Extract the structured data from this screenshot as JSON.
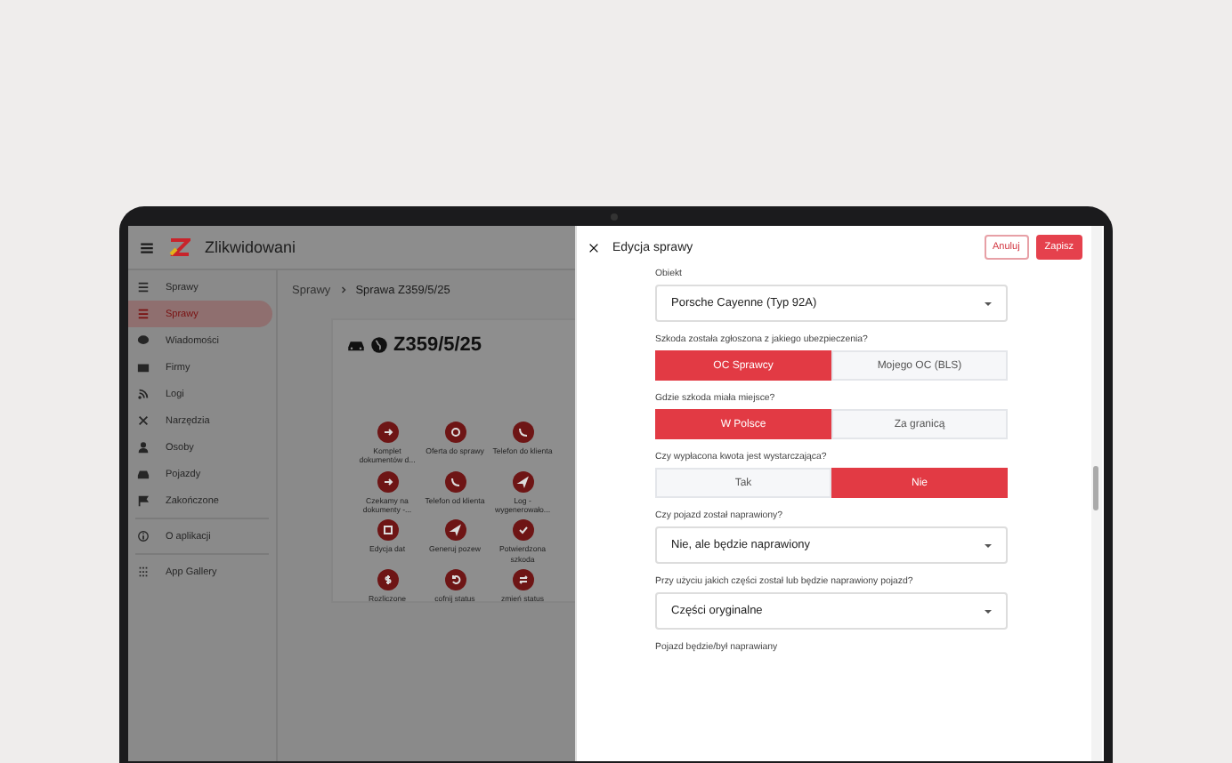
{
  "app": {
    "title": "Zlikwidowani",
    "sidebar": [
      [
        {
          "label": "Sprawy",
          "selected": false
        },
        {
          "label": "Sprawy",
          "selected": true
        },
        {
          "label": "Wiadomości",
          "selected": false
        },
        {
          "label": "Firmy",
          "selected": false
        },
        {
          "label": "Logi",
          "selected": false
        },
        {
          "label": "Narzędzia",
          "selected": false
        },
        {
          "label": "Osoby",
          "selected": false
        },
        {
          "label": "Pojazdy",
          "selected": false
        },
        {
          "label": "Zakończone",
          "selected": false
        }
      ],
      [
        {
          "label": "O aplikacji",
          "selected": false
        }
      ],
      [
        {
          "label": "App Gallery",
          "selected": false
        }
      ]
    ],
    "breadcrumb": [
      "Sprawy",
      "Sprawa Z359/5/25"
    ],
    "case": {
      "number": "Z359/5/25",
      "actions": [
        {
          "label": "Komplet dokumentów d..."
        },
        {
          "label": "Oferta do sprawy"
        },
        {
          "label": "Telefon do klienta"
        },
        {
          "label": "Czekamy na dokumenty -..."
        },
        {
          "label": "Telefon od klienta"
        },
        {
          "label": "Log - wygenerowało..."
        },
        {
          "label": "Edycja dat"
        },
        {
          "label": "Generuj pozew"
        },
        {
          "label": "Potwierdzona szkoda"
        },
        {
          "label": "Rozliczone"
        },
        {
          "label": "cofnij status"
        },
        {
          "label": "zmień status"
        }
      ]
    }
  },
  "drawer": {
    "title": "Edycja sprawy",
    "buttons": [
      {
        "label": "Anuluj",
        "kind": "outline"
      },
      {
        "label": "Zapisz",
        "kind": "primary"
      }
    ],
    "fields": [
      {
        "kind": "select",
        "label": "Obiekt",
        "value": "Porsche Cayenne (Typ 92A)"
      },
      {
        "kind": "toggle",
        "label": "Szkoda została zgłoszona z jakiego ubezpieczenia?",
        "options": [
          {
            "label": "OC Sprawcy",
            "selected": true
          },
          {
            "label": "Mojego OC (BLS)",
            "selected": false
          }
        ]
      },
      {
        "kind": "toggle",
        "label": "Gdzie szkoda miała miejsce?",
        "options": [
          {
            "label": "W Polsce",
            "selected": true
          },
          {
            "label": "Za granicą",
            "selected": false
          }
        ]
      },
      {
        "kind": "toggle",
        "label": "Czy wypłacona kwota jest wystarczająca?",
        "options": [
          {
            "label": "Tak",
            "selected": false
          },
          {
            "label": "Nie",
            "selected": true
          }
        ]
      },
      {
        "kind": "select",
        "label": "Czy pojazd został naprawiony?",
        "value": "Nie, ale będzie naprawiony"
      },
      {
        "kind": "select",
        "label": "Przy użyciu jakich części został lub będzie naprawiony pojazd?",
        "value": "Części oryginalne"
      },
      {
        "kind": "label",
        "label": "Pojazd będzie/był naprawiany"
      }
    ]
  }
}
